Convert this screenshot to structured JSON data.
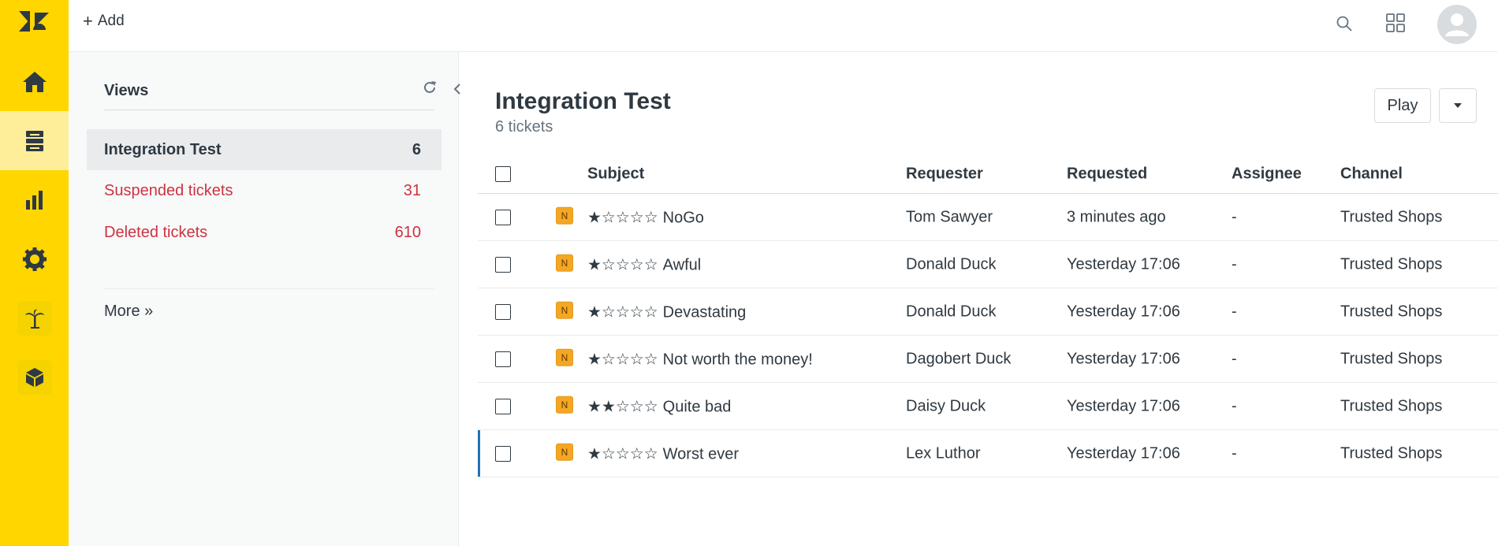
{
  "topbar": {
    "add_label": "Add"
  },
  "rail": {
    "items": [
      "home-icon",
      "tickets-icon",
      "reporting-icon",
      "admin-icon",
      "palm-tree-icon",
      "package-icon"
    ]
  },
  "views": {
    "title": "Views",
    "items": [
      {
        "label": "Integration Test",
        "count": "6"
      },
      {
        "label": "Suspended tickets",
        "count": "31"
      },
      {
        "label": "Deleted tickets",
        "count": "610"
      }
    ],
    "more_label": "More »"
  },
  "main": {
    "title": "Integration Test",
    "subtitle": "6 tickets",
    "play_label": "Play",
    "columns": {
      "subject": "Subject",
      "requester": "Requester",
      "requested": "Requested",
      "assignee": "Assignee",
      "channel": "Channel"
    },
    "rows": [
      {
        "badge": "N",
        "stars": "★☆☆☆☆",
        "subject": "NoGo",
        "requester": "Tom Sawyer",
        "requested": "3 minutes ago",
        "assignee": "-",
        "channel": "Trusted Shops"
      },
      {
        "badge": "N",
        "stars": "★☆☆☆☆",
        "subject": "Awful",
        "requester": "Donald Duck",
        "requested": "Yesterday 17:06",
        "assignee": "-",
        "channel": "Trusted Shops"
      },
      {
        "badge": "N",
        "stars": "★☆☆☆☆",
        "subject": "Devastating",
        "requester": "Donald Duck",
        "requested": "Yesterday 17:06",
        "assignee": "-",
        "channel": "Trusted Shops"
      },
      {
        "badge": "N",
        "stars": "★☆☆☆☆",
        "subject": "Not worth the money!",
        "requester": "Dagobert Duck",
        "requested": "Yesterday 17:06",
        "assignee": "-",
        "channel": "Trusted Shops"
      },
      {
        "badge": "N",
        "stars": "★★☆☆☆",
        "subject": "Quite bad",
        "requester": "Daisy Duck",
        "requested": "Yesterday 17:06",
        "assignee": "-",
        "channel": "Trusted Shops"
      },
      {
        "badge": "N",
        "stars": "★☆☆☆☆",
        "subject": "Worst ever",
        "requester": "Lex Luthor",
        "requested": "Yesterday 17:06",
        "assignee": "-",
        "channel": "Trusted Shops"
      }
    ]
  },
  "colors": {
    "rail": "#ffd600",
    "rail_active": "#ffee99",
    "danger": "#cc3340",
    "badge": "#f5a623",
    "selected_bar": "#1f73b7"
  }
}
